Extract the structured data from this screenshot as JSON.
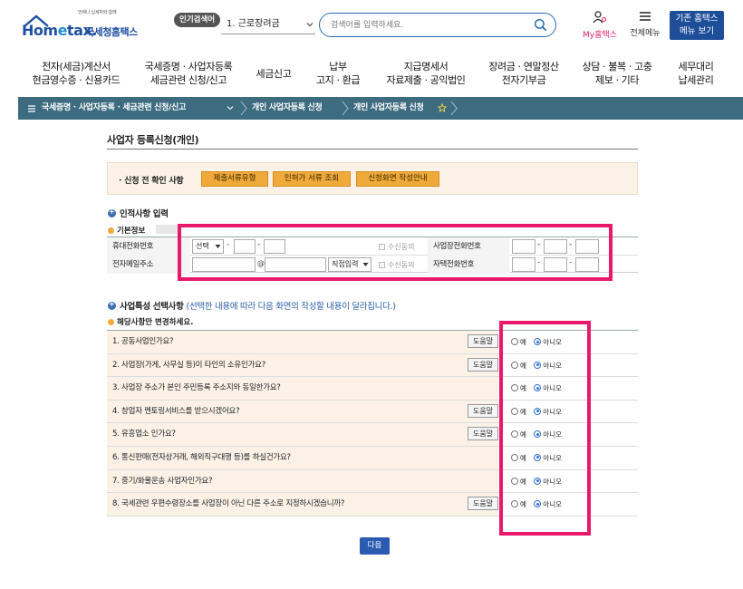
{
  "header": {
    "logo_small": "언제나 납세자와 함께",
    "logo_home": "Hom",
    "logo_e": "e",
    "logo_tax": "tax.",
    "logo_name": "국세청홈택스",
    "hot_search_badge": "인기검색어",
    "hot_search_value": "1.  근로장려금",
    "search_placeholder": "검색어를 입력하세요.",
    "my_hometax": "My홈택스",
    "all_menu": "전체메뉴",
    "old_hometax_line1": "기존 홈택스",
    "old_hometax_line2": "메뉴 보기"
  },
  "nav": [
    {
      "line1": "전자(세금)계산서",
      "line2": "현금영수증 · 신용카드"
    },
    {
      "line1": "국세증명 · 사업자등록",
      "line2": "세금관련 신청/신고"
    },
    {
      "line1": "세금신고",
      "line2": ""
    },
    {
      "line1": "납부",
      "line2": "고지 · 환급"
    },
    {
      "line1": "지급명세서",
      "line2": "자료제출 · 공익법인"
    },
    {
      "line1": "장려금 · 연말정산",
      "line2": "전자기부금"
    },
    {
      "line1": "상담 · 불복 · 고충",
      "line2": "제보 · 기타"
    },
    {
      "line1": "세무대리",
      "line2": "납세관리"
    }
  ],
  "breadcrumb": {
    "item1": "국세증명 · 사업자등록 · 세금관련 신청/신고",
    "item2": "개인 사업자등록 신청",
    "item3": "개인 사업자등록 신청"
  },
  "page": {
    "title": "사업자 등록신청(개인)",
    "precheck_label": "· 신청 전 확인 사항",
    "btn_docs": "제출서류유형",
    "btn_permit": "인허가 서류 조회",
    "btn_guide": "신청화면 작성안내",
    "section1": "인적사항 입력",
    "basic_info": "기본정보",
    "mobile_label": "휴대전화번호",
    "mobile_select": "선택",
    "sms_agree": "수신동의",
    "biz_phone_label": "사업장전화번호",
    "email_label": "전자메일주소",
    "email_at": "@",
    "email_select": "직접입력",
    "email_agree": "수신동의",
    "home_phone_label": "자택전화번호",
    "section2": "사업특성 선택사항",
    "section2_note": "(선택한 내용에 따라 다음 화면의 작성할 내용이 달라집니다.)",
    "applicable_note": "해당사항만 변경하세요.",
    "help_label": "도움말",
    "yes_label": "예",
    "no_label": "아니오",
    "next_label": "다음"
  },
  "questions": [
    {
      "text": "1. 공동사업인가요?",
      "help": true
    },
    {
      "text": "2. 사업장(가게, 사무실 등)이 타인의 소유인가요?",
      "help": true
    },
    {
      "text": "3. 사업장 주소가 본인 주민등록 주소지와 동일한가요?",
      "help": false
    },
    {
      "text": "4. 창업자 멘토링서비스를 받으시겠어요?",
      "help": true
    },
    {
      "text": "5. 유흥업소 인가요?",
      "help": true
    },
    {
      "text": "6. 통신판매(전자상거래, 해외직구대행 등)를 하실건가요?",
      "help": false
    },
    {
      "text": "7. 중기/화물운송 사업자인가요?",
      "help": false
    },
    {
      "text": "8. 국세관련 우편수령장소를 사업장이 아닌 다른 주소로 지정하시겠습니까?",
      "help": true
    }
  ],
  "colors": {
    "brand_blue": "#1f4e99",
    "breadcrumb_bg": "#3d6b80",
    "highlight": "#e8196b",
    "orange_button": "#f0aa3a",
    "section_bg": "#fbf1e6"
  }
}
